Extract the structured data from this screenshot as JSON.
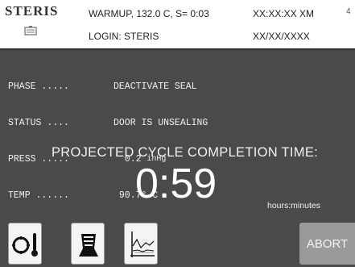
{
  "header": {
    "logo": "STERIS",
    "status_line": "WARMUP, 132.0 C, S= 0:03",
    "login": "LOGIN: STERIS",
    "time": "XX:XX:XX XM",
    "date": "XX/XX/XXXX",
    "screen_number": "4"
  },
  "status": {
    "rows": [
      {
        "label": "PHASE .....",
        "value": "DEACTIVATE SEAL"
      },
      {
        "label": "STATUS ....",
        "value": "DOOR IS UNSEALING"
      },
      {
        "label": "PRESS .....",
        "value": "  0.2 ",
        "unit": "inHg"
      },
      {
        "label": "TEMP ......",
        "value": " 90.7° C"
      }
    ]
  },
  "projection": {
    "label": "PROJECTED CYCLE COMPLETION TIME:",
    "time": "0:59",
    "unit": "hours:minutes"
  },
  "buttons": {
    "temperature_icon": "gauge-thermometer-icon",
    "printer_icon": "printer-icon",
    "graph_icon": "graph-icon",
    "abort_label": "ABORT"
  }
}
